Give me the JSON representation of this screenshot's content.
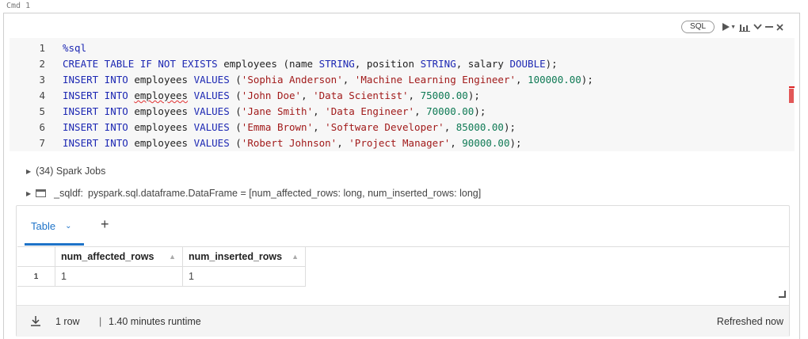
{
  "cmd_label": "Cmd 1",
  "toolbar": {
    "language": "SQL"
  },
  "code_lines": [
    {
      "n": "1",
      "parts": [
        {
          "t": "%sql",
          "c": "kw"
        }
      ]
    },
    {
      "n": "2",
      "parts": [
        {
          "t": "CREATE TABLE IF NOT EXISTS ",
          "c": "kw"
        },
        {
          "t": "employees (name ",
          "c": ""
        },
        {
          "t": "STRING",
          "c": "kw"
        },
        {
          "t": ", position ",
          "c": ""
        },
        {
          "t": "STRING",
          "c": "kw"
        },
        {
          "t": ", salary ",
          "c": ""
        },
        {
          "t": "DOUBLE",
          "c": "kw"
        },
        {
          "t": ");",
          "c": ""
        }
      ]
    },
    {
      "n": "3",
      "parts": [
        {
          "t": "INSERT INTO ",
          "c": "kw"
        },
        {
          "t": "employees ",
          "c": ""
        },
        {
          "t": "VALUES ",
          "c": "kw"
        },
        {
          "t": "(",
          "c": ""
        },
        {
          "t": "'Sophia Anderson'",
          "c": "str"
        },
        {
          "t": ", ",
          "c": ""
        },
        {
          "t": "'Machine Learning Engineer'",
          "c": "str"
        },
        {
          "t": ", ",
          "c": ""
        },
        {
          "t": "100000.00",
          "c": "num"
        },
        {
          "t": ");",
          "c": ""
        }
      ]
    },
    {
      "n": "4",
      "parts": [
        {
          "t": "INSERT INTO ",
          "c": "kw"
        },
        {
          "t": "employees",
          "c": "squiggle"
        },
        {
          "t": " ",
          "c": ""
        },
        {
          "t": "VALUES ",
          "c": "kw"
        },
        {
          "t": "(",
          "c": ""
        },
        {
          "t": "'John Doe'",
          "c": "str"
        },
        {
          "t": ", ",
          "c": ""
        },
        {
          "t": "'Data Scientist'",
          "c": "str"
        },
        {
          "t": ", ",
          "c": ""
        },
        {
          "t": "75000.00",
          "c": "num"
        },
        {
          "t": ");",
          "c": ""
        }
      ]
    },
    {
      "n": "5",
      "parts": [
        {
          "t": "INSERT INTO ",
          "c": "kw"
        },
        {
          "t": "employees ",
          "c": ""
        },
        {
          "t": "VALUES ",
          "c": "kw"
        },
        {
          "t": "(",
          "c": ""
        },
        {
          "t": "'Jane Smith'",
          "c": "str"
        },
        {
          "t": ", ",
          "c": ""
        },
        {
          "t": "'Data Engineer'",
          "c": "str"
        },
        {
          "t": ", ",
          "c": ""
        },
        {
          "t": "70000.00",
          "c": "num"
        },
        {
          "t": ");",
          "c": ""
        }
      ]
    },
    {
      "n": "6",
      "parts": [
        {
          "t": "INSERT INTO ",
          "c": "kw"
        },
        {
          "t": "employees ",
          "c": ""
        },
        {
          "t": "VALUES ",
          "c": "kw"
        },
        {
          "t": "(",
          "c": ""
        },
        {
          "t": "'Emma Brown'",
          "c": "str"
        },
        {
          "t": ", ",
          "c": ""
        },
        {
          "t": "'Software Developer'",
          "c": "str"
        },
        {
          "t": ", ",
          "c": ""
        },
        {
          "t": "85000.00",
          "c": "num"
        },
        {
          "t": ");",
          "c": ""
        }
      ]
    },
    {
      "n": "7",
      "parts": [
        {
          "t": "INSERT INTO ",
          "c": "kw"
        },
        {
          "t": "employees ",
          "c": ""
        },
        {
          "t": "VALUES ",
          "c": "kw"
        },
        {
          "t": "(",
          "c": ""
        },
        {
          "t": "'Robert Johnson'",
          "c": "str"
        },
        {
          "t": ", ",
          "c": ""
        },
        {
          "t": "'Project Manager'",
          "c": "str"
        },
        {
          "t": ", ",
          "c": ""
        },
        {
          "t": "90000.00",
          "c": "num"
        },
        {
          "t": ");",
          "c": ""
        }
      ]
    }
  ],
  "spark_jobs": "(34) Spark Jobs",
  "df_info": {
    "name": "_sqldf:",
    "type": "pyspark.sql.dataframe.DataFrame = [num_affected_rows: long, num_inserted_rows: long]"
  },
  "output": {
    "tab_label": "Table",
    "add_label": "+",
    "columns": [
      "num_affected_rows",
      "num_inserted_rows"
    ],
    "rows": [
      {
        "index": "1",
        "cells": [
          "1",
          "1"
        ]
      }
    ],
    "footer": {
      "row_count": "1 row",
      "separator": "|",
      "runtime": "1.40 minutes runtime",
      "refreshed": "Refreshed now"
    }
  },
  "colors": {
    "keyword": "#1d28b3",
    "string": "#a11a1a",
    "number": "#0f7a55",
    "accent": "#1e73c8"
  },
  "icons": [
    "play-icon",
    "chart-icon",
    "chevron-down-icon",
    "minimize-icon",
    "close-icon",
    "table-icon",
    "download-icon",
    "resize-icon"
  ]
}
